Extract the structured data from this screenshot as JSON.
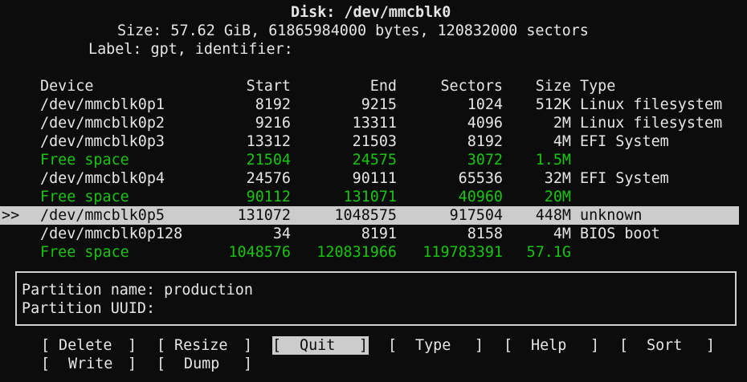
{
  "header": {
    "disk_line": "Disk: /dev/mmcblk0",
    "size_line": "Size: 57.62 GiB, 61865984000 bytes, 120832000 sectors",
    "label_line": "Label: gpt, identifier:"
  },
  "table": {
    "columns": {
      "device": "Device",
      "start": "Start",
      "end": "End",
      "sectors": "Sectors",
      "size": "Size",
      "type": "Type"
    },
    "selection_marker": ">>",
    "rows": [
      {
        "device": "/dev/mmcblk0p1",
        "start": "8192",
        "end": "9215",
        "sectors": "1024",
        "size": "512K",
        "type": "Linux filesystem"
      },
      {
        "device": "/dev/mmcblk0p2",
        "start": "9216",
        "end": "13311",
        "sectors": "4096",
        "size": "2M",
        "type": "Linux filesystem"
      },
      {
        "device": "/dev/mmcblk0p3",
        "start": "13312",
        "end": "21503",
        "sectors": "8192",
        "size": "4M",
        "type": "EFI System"
      },
      {
        "device": "Free space",
        "start": "21504",
        "end": "24575",
        "sectors": "3072",
        "size": "1.5M",
        "type": ""
      },
      {
        "device": "/dev/mmcblk0p4",
        "start": "24576",
        "end": "90111",
        "sectors": "65536",
        "size": "32M",
        "type": "EFI System"
      },
      {
        "device": "Free space",
        "start": "90112",
        "end": "131071",
        "sectors": "40960",
        "size": "20M",
        "type": ""
      },
      {
        "device": "/dev/mmcblk0p5",
        "start": "131072",
        "end": "1048575",
        "sectors": "917504",
        "size": "448M",
        "type": "unknown"
      },
      {
        "device": "/dev/mmcblk0p128",
        "start": "34",
        "end": "8191",
        "sectors": "8158",
        "size": "4M",
        "type": "BIOS boot"
      },
      {
        "device": "Free space",
        "start": "1048576",
        "end": "120831966",
        "sectors": "119783391",
        "size": "57.1G",
        "type": ""
      }
    ]
  },
  "info": {
    "name_label": "Partition name:",
    "name_value": "production",
    "uuid_label": "Partition UUID:",
    "uuid_value": ""
  },
  "menu": {
    "delete": "Delete",
    "resize": "Resize",
    "quit": "Quit",
    "type": "Type",
    "help": "Help",
    "sort": "Sort",
    "write": "Write",
    "dump": "Dump",
    "open_bracket": "[",
    "close_bracket": "]",
    "active": "quit"
  },
  "colors": {
    "background": "#0c0c0c",
    "text": "#e6e6e6",
    "free_space": "#16c60c",
    "selection": "#cccccc"
  }
}
